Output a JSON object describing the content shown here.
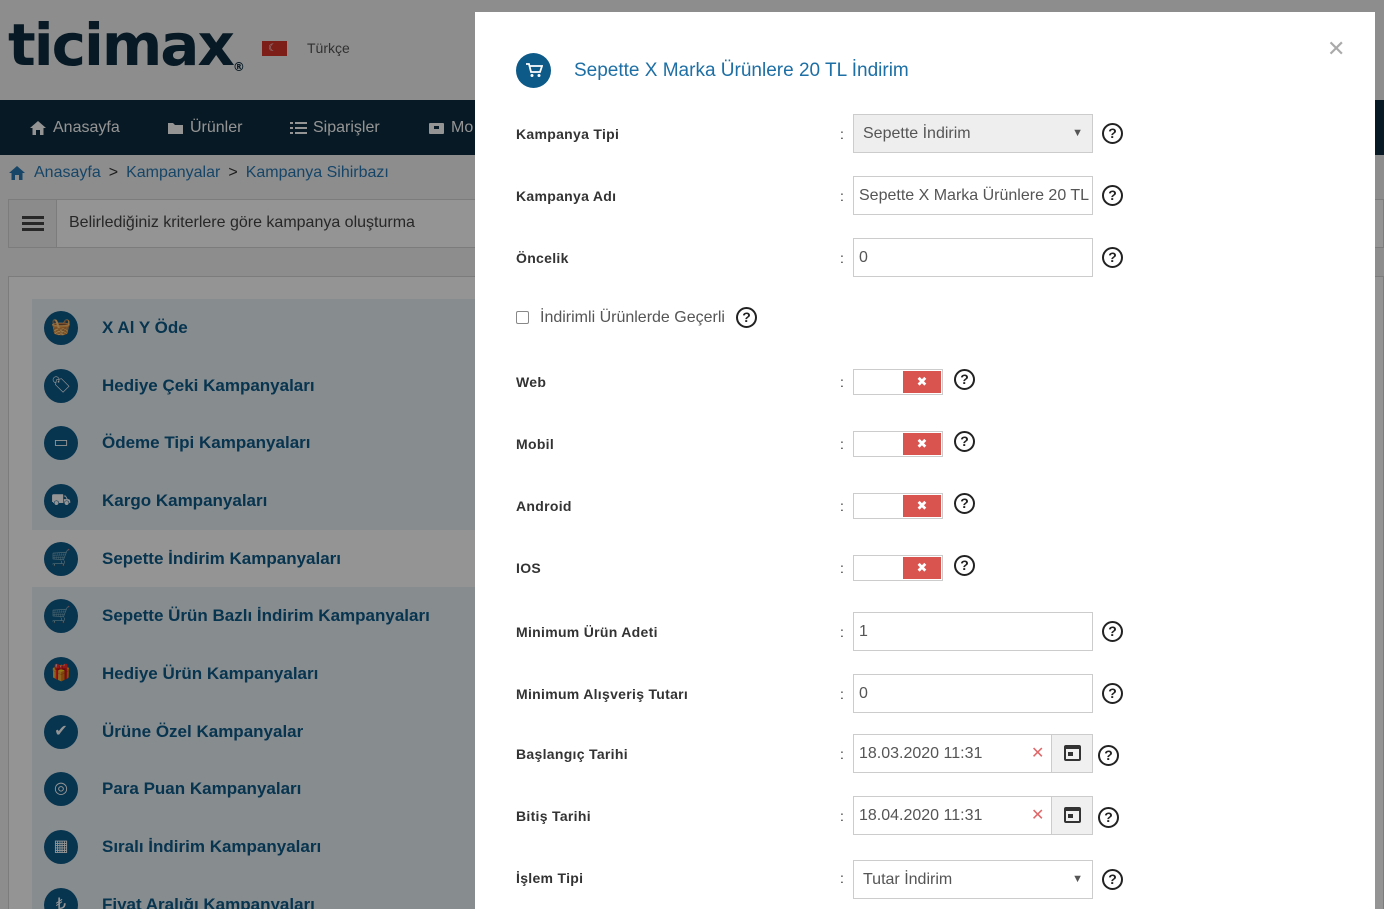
{
  "header": {
    "logo": "ticimax",
    "logo_mark": "®",
    "language": "Türkçe"
  },
  "nav": [
    {
      "label": "Anasayfa",
      "icon": "home-icon"
    },
    {
      "label": "Ürünler",
      "icon": "folder-icon"
    },
    {
      "label": "Siparişler",
      "icon": "list-icon"
    },
    {
      "label": "Mo",
      "icon": "box-icon"
    }
  ],
  "breadcrumb": [
    "Anasayfa",
    "Kampanyalar",
    "Kampanya Sihirbazı"
  ],
  "breadcrumb_sep": ">",
  "subheader": "Belirlediğiniz kriterlere göre kampanya oluşturma",
  "campaigns": [
    {
      "label": "X Al Y Öde",
      "icon": "basket-icon"
    },
    {
      "label": "Hediye Çeki Kampanyaları",
      "icon": "tag-icon"
    },
    {
      "label": "Ödeme Tipi Kampanyaları",
      "icon": "credit-card-icon"
    },
    {
      "label": "Kargo Kampanyaları",
      "icon": "truck-icon"
    },
    {
      "label": "Sepette İndirim Kampanyaları",
      "icon": "cart-icon"
    },
    {
      "label": "Sepette Ürün Bazlı İndirim Kampanyaları",
      "icon": "cart-icon"
    },
    {
      "label": "Hediye Ürün Kampanyaları",
      "icon": "gift-icon"
    },
    {
      "label": "Ürüne Özel Kampanyalar",
      "icon": "product-check-icon"
    },
    {
      "label": "Para Puan Kampanyaları",
      "icon": "coins-icon"
    },
    {
      "label": "Sıralı İndirim Kampanyaları",
      "icon": "stacked-boxes-icon"
    },
    {
      "label": "Fiyat Aralığı Kampanyaları",
      "icon": "price-tag-icon"
    }
  ],
  "active_campaign": "Sepette İndirim Kampanyaları",
  "modal": {
    "title": "Sepette X Marka Ürünlere 20 TL İndirim",
    "colon": ":",
    "help": "?",
    "fields": {
      "kampanya_tipi": {
        "label": "Kampanya Tipi",
        "value": "Sepette İndirim"
      },
      "kampanya_adi": {
        "label": "Kampanya Adı",
        "value": "Sepette X Marka Ürünlere 20 TL İndirim"
      },
      "oncelik": {
        "label": "Öncelik",
        "value": "0"
      },
      "indirimli": {
        "label": "İndirimli Ürünlerde Geçerli",
        "checked": false
      },
      "web": {
        "label": "Web",
        "enabled": false
      },
      "mobil": {
        "label": "Mobil",
        "enabled": false
      },
      "android": {
        "label": "Android",
        "enabled": false
      },
      "ios": {
        "label": "IOS",
        "enabled": false
      },
      "min_urun": {
        "label": "Minimum Ürün Adeti",
        "value": "1"
      },
      "min_tutar": {
        "label": "Minimum Alışveriş Tutarı",
        "value": "0"
      },
      "baslangic": {
        "label": "Başlangıç Tarihi",
        "value": "18.03.2020 11:31"
      },
      "bitis": {
        "label": "Bitiş Tarihi",
        "value": "18.04.2020 11:31"
      },
      "islem_tipi": {
        "label": "İşlem Tipi",
        "value": "Tutar İndirim"
      }
    },
    "toggle_off_glyph": "✖",
    "clear_glyph": "✕"
  }
}
